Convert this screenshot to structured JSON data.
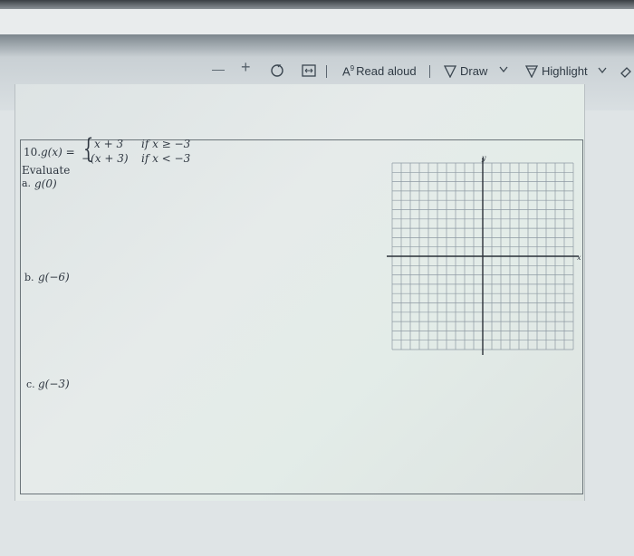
{
  "toolbar": {
    "minus_glyph": "—",
    "plus_glyph": "+",
    "read_aloud_prefix": "A",
    "read_aloud_sup": "́",
    "read_aloud_label": "Read aloud",
    "draw_label": "Draw",
    "highlight_label": "Highlight"
  },
  "problem": {
    "number": "10.",
    "func": "g(x) =",
    "case1_expr": "x + 3",
    "case1_cond": "if x ≥ −3",
    "case2_expr": "−(x + 3)",
    "case2_cond": "if x < −3",
    "evaluate": "Evaluate",
    "parts": [
      {
        "label": "a.",
        "expr": "g(0)"
      },
      {
        "label": "b.",
        "expr": "g(−6)"
      },
      {
        "label": "c.",
        "expr": "g(−3)"
      }
    ]
  },
  "graph": {
    "x_axis_label": "x",
    "y_axis_label": "y",
    "columns": 20,
    "rows": 20
  },
  "colors": {
    "grid_line": "#8e9aa3",
    "axis": "#2b3138"
  }
}
